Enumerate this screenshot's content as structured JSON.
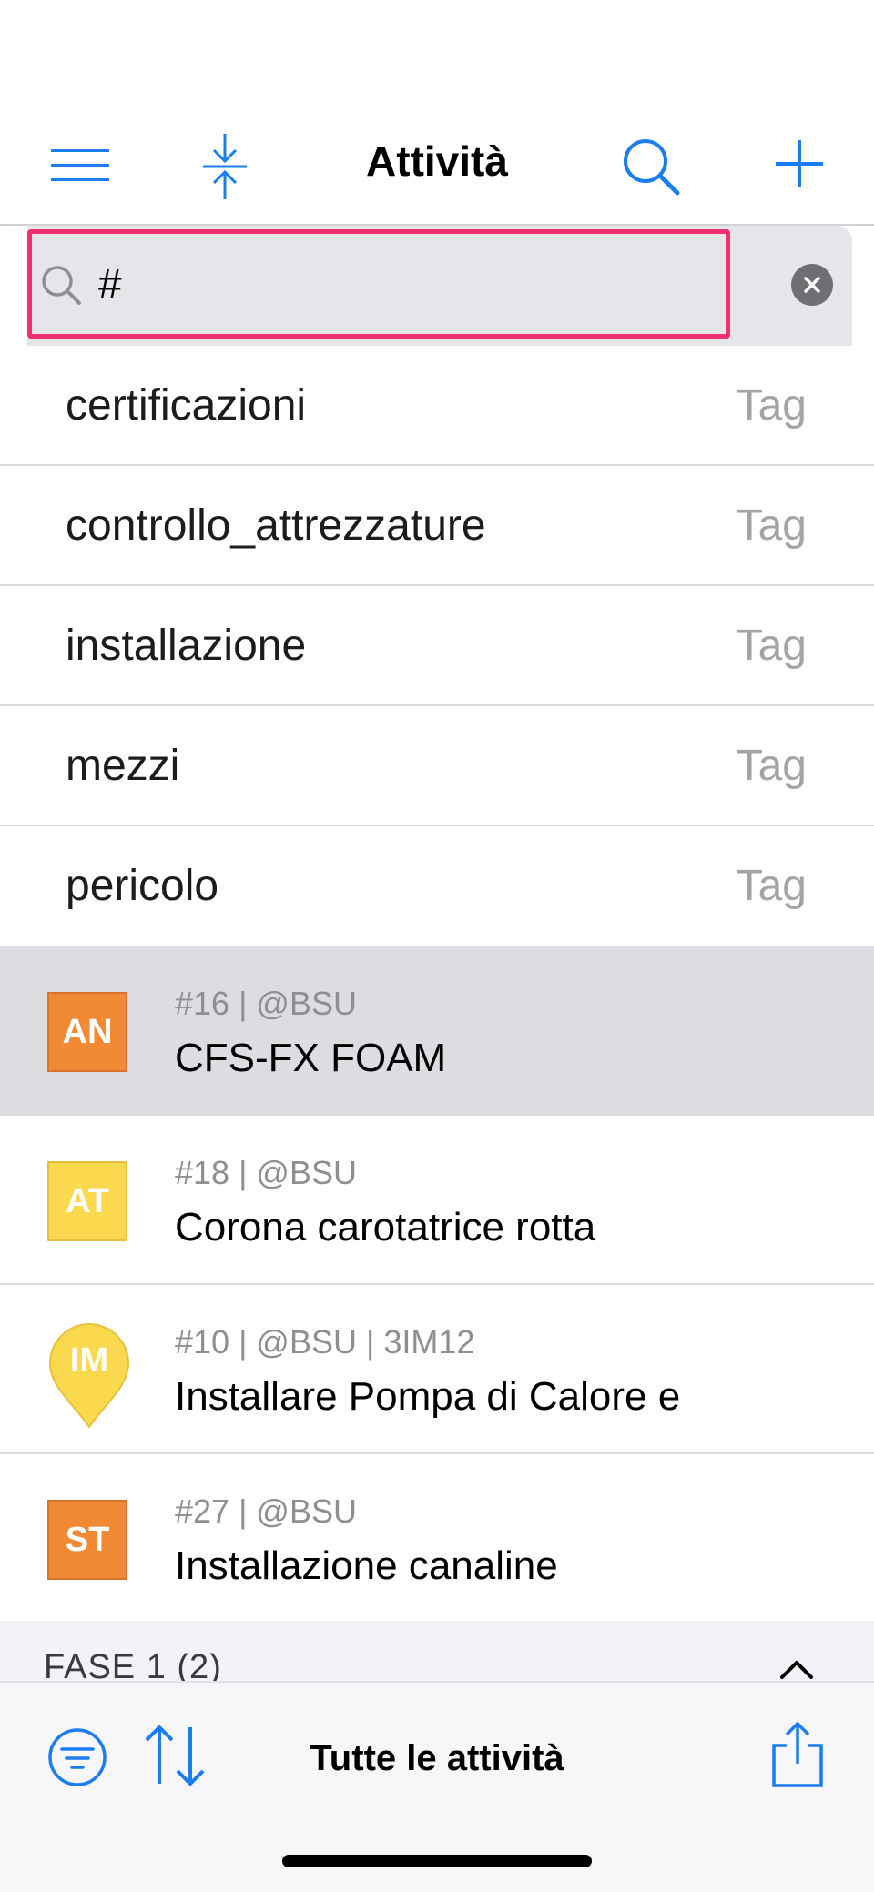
{
  "header": {
    "title": "Attività",
    "menu_icon": "hamburger-menu-icon",
    "collapse_icon": "collapse-arrows-icon",
    "search_icon": "magnifier-icon",
    "add_icon": "plus-icon"
  },
  "search": {
    "value": "#",
    "icon": "magnifier-icon",
    "clear_icon": "clear-x-icon"
  },
  "tags": [
    {
      "name": "certificazioni",
      "kind": "Tag"
    },
    {
      "name": "controllo_attrezzature",
      "kind": "Tag"
    },
    {
      "name": "installazione",
      "kind": "Tag"
    },
    {
      "name": "mezzi",
      "kind": "Tag"
    },
    {
      "name": "pericolo",
      "kind": "Tag"
    }
  ],
  "tasks": [
    {
      "initials": "AN",
      "meta": "#16 | @BSU",
      "title": "CFS-FX FOAM",
      "color": "#f28a35",
      "shape": "square",
      "selected": true
    },
    {
      "initials": "AT",
      "meta": "#18 | @BSU",
      "title": "Corona carotatrice rotta",
      "color": "#fbd94e",
      "shape": "square",
      "selected": false
    },
    {
      "initials": "IM",
      "meta": "#10 | @BSU | 3IM12",
      "title": "Installare Pompa di Calore e",
      "color": "#fbd94e",
      "shape": "pin",
      "selected": false
    },
    {
      "initials": "ST",
      "meta": "#27 | @BSU",
      "title": "Installazione canaline",
      "color": "#f28a35",
      "shape": "square",
      "selected": false
    }
  ],
  "section": {
    "label": "FASE 1  (2)",
    "chevron_icon": "chevron-up-icon"
  },
  "toolbar": {
    "title": "Tutte le attività",
    "filter_icon": "filter-icon",
    "sort_icon": "sort-arrows-icon",
    "share_icon": "share-icon"
  },
  "colors": {
    "accent": "#1a7ef0",
    "highlight": "#f0316f",
    "selected_row": "#dcdce1"
  }
}
